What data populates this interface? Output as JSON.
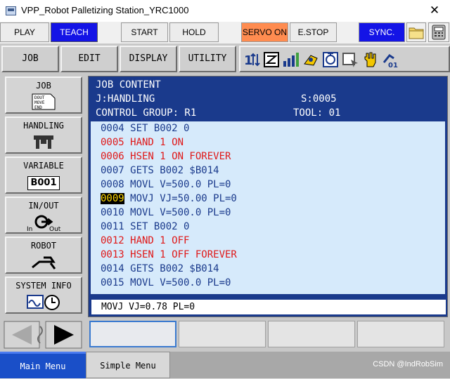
{
  "window": {
    "title": "VPP_Robot Palletizing Station_YRC1000",
    "close_glyph": "✕"
  },
  "topbar": {
    "play": "PLAY",
    "teach": "TEACH",
    "start": "START",
    "hold": "HOLD",
    "servo_on": "SERVO ON",
    "estop": "E.STOP",
    "sync": "SYNC."
  },
  "menubar": {
    "job": "JOB",
    "edit": "EDIT",
    "display": "DISPLAY",
    "utility": "UTILITY"
  },
  "sidemenu": {
    "job": {
      "label": "JOB",
      "icon_lines": [
        "DOUT",
        "MOVE",
        "END"
      ]
    },
    "handling": {
      "label": "HANDLING"
    },
    "variable": {
      "label": "VARIABLE",
      "value": "B001"
    },
    "inout": {
      "label": "IN/OUT",
      "in": "In",
      "out": "Out"
    },
    "robot": {
      "label": "ROBOT"
    },
    "system_info": {
      "label": "SYSTEM INFO"
    }
  },
  "job": {
    "header": "JOB CONTENT",
    "name": "J:HANDLING",
    "step": "S:0005",
    "control_group": "CONTROL GROUP: R1",
    "tool": "TOOL: 01",
    "current_line_number": "0009",
    "lines": [
      {
        "text": "0004 SET B002 0",
        "color": "blue"
      },
      {
        "text": "0005 HAND 1 ON",
        "color": "red"
      },
      {
        "text": "0006 HSEN 1 ON FOREVER",
        "color": "red"
      },
      {
        "text": "0007 GETS B002 $B014",
        "color": "blue"
      },
      {
        "text": "0008 MOVL V=500.0 PL=0",
        "color": "blue"
      },
      {
        "text": " MOVJ VJ=50.00 PL=0",
        "color": "blue"
      },
      {
        "text": "0010 MOVL V=500.0 PL=0",
        "color": "blue"
      },
      {
        "text": "0011 SET B002 0",
        "color": "blue"
      },
      {
        "text": "0012 HAND 1 OFF",
        "color": "red"
      },
      {
        "text": "0013 HSEN 1 OFF FOREVER",
        "color": "red"
      },
      {
        "text": "0014 GETS B002 $B014",
        "color": "blue"
      },
      {
        "text": "0015 MOVL V=500.0 PL=0",
        "color": "blue"
      }
    ],
    "edit_buffer": "MOVJ VJ=0.78 PL=0"
  },
  "bottombar": {
    "main_menu": "Main Menu",
    "simple_menu": "Simple Menu",
    "watermark": "CSDN @IndRobSim"
  },
  "colors": {
    "panel_blue": "#1a3a8c",
    "list_bg": "#d6eafb",
    "red_text": "#e01818",
    "teach_blue": "#1414e6",
    "servo_orange": "#ff8c50"
  }
}
